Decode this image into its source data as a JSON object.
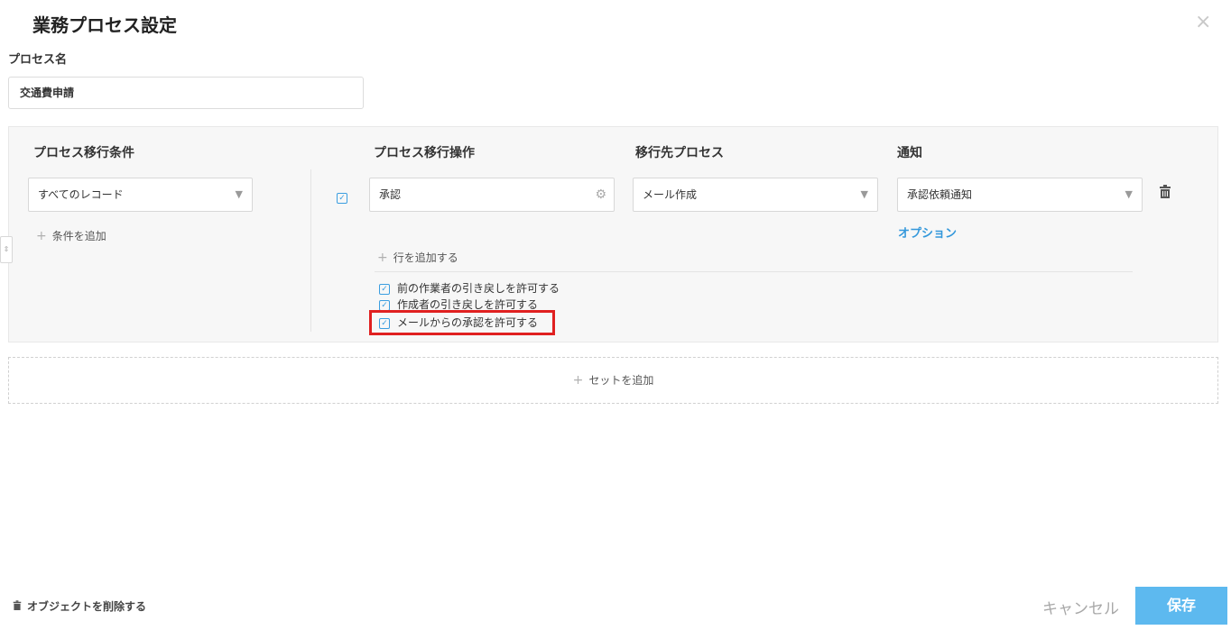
{
  "dialog": {
    "title": "業務プロセス設定",
    "close_icon": "×"
  },
  "process_name": {
    "label": "プロセス名",
    "value": "交通費申請"
  },
  "columns": {
    "condition": "プロセス移行条件",
    "action": "プロセス移行操作",
    "destination": "移行先プロセス",
    "notification": "通知"
  },
  "row": {
    "condition_value": "すべてのレコード",
    "add_condition": "条件を追加",
    "action_value": "承認",
    "destination_value": "メール作成",
    "notification_value": "承認依頼通知",
    "option_link": "オプション",
    "add_row": "行を追加する"
  },
  "permissions": [
    "前の作業者の引き戻しを許可する",
    "作成者の引き戻しを許可する",
    "メールからの承認を許可する"
  ],
  "add_set": "セットを追加",
  "footer": {
    "delete_object": "オブジェクトを削除する",
    "cancel": "キャンセル",
    "save": "保存"
  },
  "colors": {
    "accent": "#5db9ef",
    "link": "#3498db",
    "highlight": "#e02020"
  },
  "icons": {
    "caret": "▼",
    "gear": "⚙",
    "trash": "🗑",
    "plus": "+",
    "check": "✓"
  }
}
